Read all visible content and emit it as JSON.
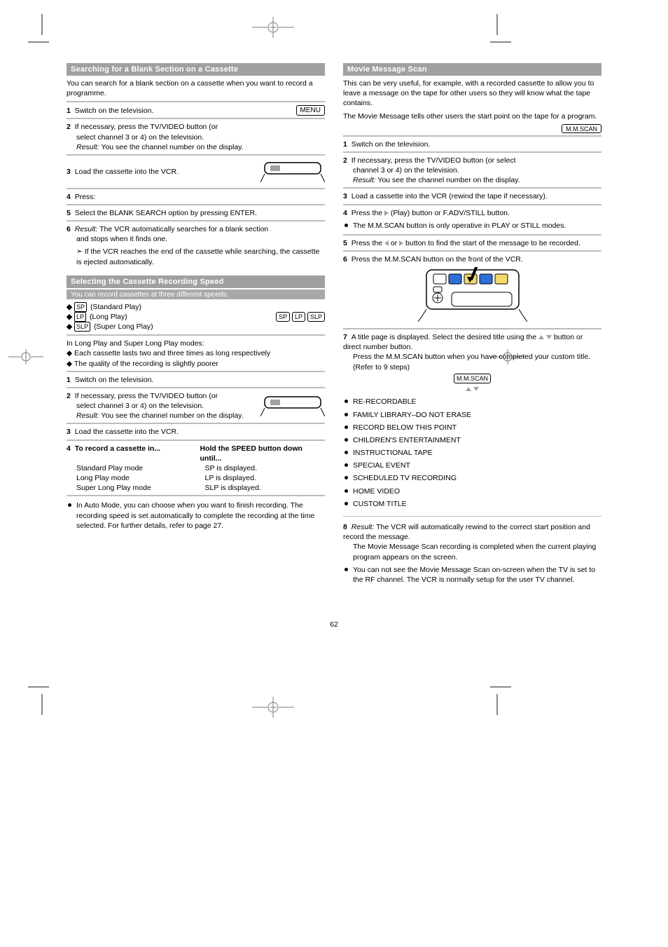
{
  "page_number": "62",
  "button_menu": "MENU",
  "button_sp": "SP",
  "button_lp": "LP",
  "button_slp": "SLP",
  "button_mms": "M.M.SCAN",
  "symbol_play": "▶",
  "left": {
    "hdr_blank": "Searching for a Blank Section on a Cassette",
    "blank_intro": "You can search for a blank section on a cassette when you want to record a programme.",
    "step1": "Switch on the television.",
    "step2_a": "If necessary, press the TV/VIDEO button (or",
    "step2_b": "select channel 3 or 4) on the television.",
    "step2_result": "You see the channel number on the display.",
    "step2_dev": "Result:",
    "step3": "Load the cassette into the VCR.",
    "step4": "Press:",
    "step5": "Select the BLANK SEARCH option by pressing ENTER.",
    "step6_a": "The VCR automatically searches for a blank section",
    "step6_b": "and stops when it finds one.",
    "step6_dev": "Result:",
    "step6_note": "If the VCR reaches the end of the cassette while searching, the cassette is ejected automatically.",
    "hdr_speed": "Selecting the Cassette Recording Speed",
    "speed_intro": "You can record cassettes at three different speeds:",
    "speed_sp": "(Standard Play)",
    "speed_lp": "(Long Play)",
    "speed_slp": "(Super Long Play)",
    "lpnote_a": "In Long Play and Super Long Play modes:",
    "lpnote_b": "Each cassette lasts two and three times as long respectively",
    "lpnote_c": "The quality of the recording is slightly poorer",
    "step1b": "Switch on the television.",
    "step2c": "If necessary, press the TV/VIDEO button (or",
    "step2d": "select channel 3 or 4) on the television.",
    "step2e": "You see the channel number on the display.",
    "step2f": "Result:",
    "step3b": "Load the cassette into the VCR.",
    "step4b": "To record a cassette in...",
    "step4c": "Standard Play mode",
    "step4d": "Long Play mode",
    "step4e": "Super Long Play mode",
    "step4f": "Hold the SPEED button down until...",
    "step4g": "SP is displayed.",
    "step4h": "LP is displayed.",
    "step4i": "SLP is displayed.",
    "note_amode": "In Auto Mode, you can choose when you want to finish recording. The recording speed is set automatically to complete the recording at the time selected. For further details, refer to page 27."
  },
  "right": {
    "hdr_mms": "Movie Message Scan",
    "intro_a": "This can be very useful, for example, with a recorded cassette to allow you to leave a message on the tape for other users so they will know what the tape contains.",
    "intro_b": "The Movie Message tells other users the start point on the tape for a program.",
    "s1": "Switch on the television.",
    "s2a": "If necessary, press the TV/VIDEO button (or select",
    "s2b": "channel 3 or 4) on the television.",
    "s2c": "You see the channel number on the display.",
    "s2d": "Result:",
    "s3": "Load a cassette into the VCR (rewind the tape if necessary).",
    "s4a": "Press the ",
    "s4b": " (Play) button or F.ADV/STILL button.",
    "s4note": "The M.M.SCAN button is only operative in PLAY or STILL modes.",
    "s5a": "Press the ",
    "s5b": " or ",
    "s5c": " button to find the start of the message to be recorded.",
    "s6": "Press the M.M.SCAN button on the front of the VCR.",
    "s7a_a": "A title page is displayed. Select the desired title using the",
    "s7a_b": " ",
    "s7a_c": " button or direct number button.",
    "s7b": "Press the M.M.SCAN button when you have completed your custom title. (Refer to 9 steps)",
    "titles_label": "(      ) button or direct number button.",
    "titles": [
      "RE-RECORDABLE",
      "FAMILY LIBRARY–DO NOT ERASE",
      "RECORD BELOW THIS POINT",
      "CHILDREN'S ENTERTAINMENT",
      "INSTRUCTIONAL TAPE",
      "SPECIAL EVENT",
      "SCHEDULED TV RECORDING",
      "HOME VIDEO",
      "CUSTOM TITLE"
    ],
    "s8a": "The VCR will automatically rewind to the correct start position and record the message.",
    "s8b": "The Movie Message Scan recording is completed when the current playing program appears on the screen.",
    "s8note": "You can not see the Movie Message Scan on-screen when the TV is set to the RF channel. The VCR is normally setup for the user TV channel."
  }
}
